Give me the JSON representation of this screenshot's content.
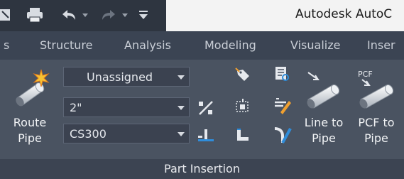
{
  "title_bar": {
    "app_title": "Autodesk AutoC",
    "quick_access": {
      "icons": [
        "app-icon",
        "print-icon",
        "undo-icon",
        "dropdown-icon",
        "redo-icon",
        "dropdown-icon",
        "customize-icon"
      ]
    }
  },
  "ribbon_tabs": [
    {
      "label": "s"
    },
    {
      "label": "Structure"
    },
    {
      "label": "Analysis"
    },
    {
      "label": "Modeling"
    },
    {
      "label": "Visualize"
    },
    {
      "label": "Inser"
    }
  ],
  "panel": {
    "title": "Part Insertion",
    "route_pipe": {
      "line1": "Route",
      "line2": "Pipe"
    },
    "spec_dropdown": {
      "value": "Unassigned"
    },
    "size_dropdown": {
      "value": "2\""
    },
    "class_dropdown": {
      "value": "CS300"
    },
    "line_to_pipe": {
      "line1": "Line to",
      "line2": "Pipe"
    },
    "pcf_to_pipe": {
      "line1": "PCF to",
      "line2": "Pipe",
      "icon_text": "PCF"
    }
  },
  "colors": {
    "qat_background": "#2e3540",
    "tab_bar": "#3b4453",
    "panel_background": "#4a5361",
    "panel_footer": "#3c4452",
    "accent_blue": "#2f8ddb",
    "accent_orange": "#f0a030"
  }
}
